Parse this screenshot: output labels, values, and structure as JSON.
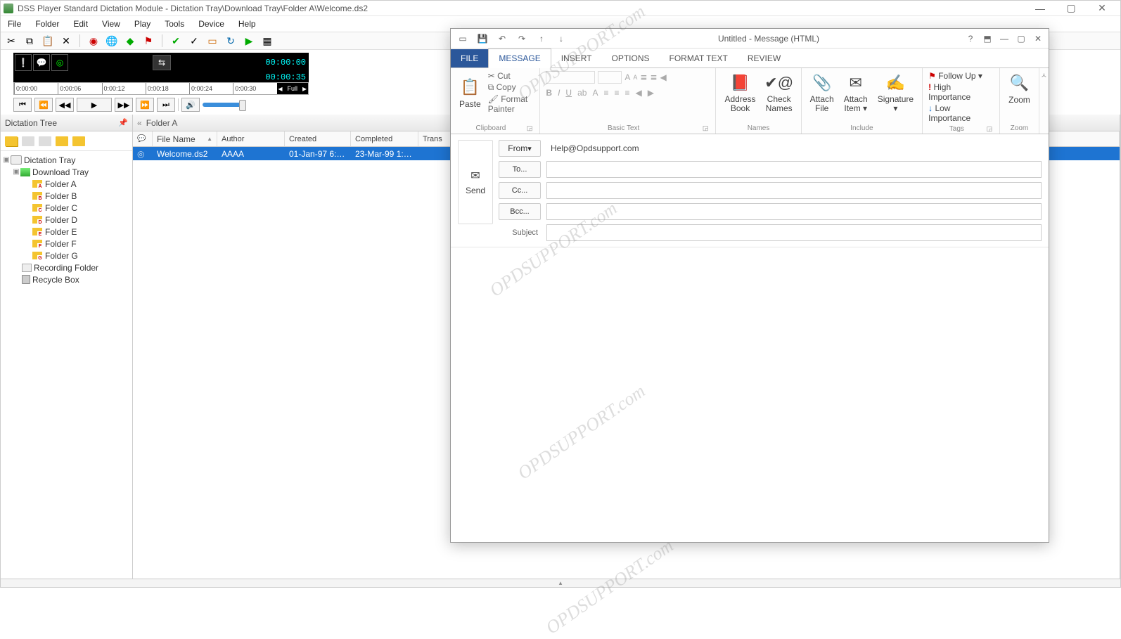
{
  "dss": {
    "title": "DSS Player Standard Dictation Module - Dictation Tray\\Download Tray\\Folder A\\Welcome.ds2",
    "menu": [
      "File",
      "Folder",
      "Edit",
      "View",
      "Play",
      "Tools",
      "Device",
      "Help"
    ],
    "time_current": "00:00:00",
    "time_total": "00:00:35",
    "ticks": [
      "0:00:00",
      "0:00:06",
      "0:00:12",
      "0:00:18",
      "0:00:24",
      "0:00:30"
    ],
    "full_label": "Full",
    "tree_header": "Dictation Tree",
    "tree": {
      "root": "Dictation Tray",
      "download": "Download Tray",
      "folders": [
        "Folder A",
        "Folder B",
        "Folder C",
        "Folder D",
        "Folder E",
        "Folder F",
        "Folder G"
      ],
      "folder_badges": [
        "A",
        "B",
        "C",
        "D",
        "E",
        "F",
        "G"
      ],
      "recording": "Recording Folder",
      "recycle": "Recycle Box"
    },
    "file_header": "Folder A",
    "columns": [
      "",
      "File Name",
      "Author",
      "Created",
      "Completed",
      "Trans"
    ],
    "row": {
      "filename": "Welcome.ds2",
      "author": "AAAA",
      "created": "01-Jan-97 6:1...",
      "completed": "23-Mar-99 1:5..."
    }
  },
  "outlook": {
    "title": "Untitled - Message (HTML)",
    "tabs": [
      "FILE",
      "MESSAGE",
      "INSERT",
      "OPTIONS",
      "FORMAT TEXT",
      "REVIEW"
    ],
    "clipboard": {
      "paste": "Paste",
      "cut": "Cut",
      "copy": "Copy",
      "format_painter": "Format Painter",
      "label": "Clipboard"
    },
    "basictext": {
      "label": "Basic Text"
    },
    "names": {
      "address_book": "Address Book",
      "check_names": "Check Names",
      "label": "Names"
    },
    "include": {
      "attach_file": "Attach File",
      "attach_item": "Attach Item",
      "signature": "Signature",
      "label": "Include"
    },
    "tags": {
      "follow": "Follow Up",
      "high": "High Importance",
      "low": "Low Importance",
      "label": "Tags"
    },
    "zoom": {
      "zoom": "Zoom",
      "label": "Zoom"
    },
    "send": "Send",
    "from_label": "From",
    "from_value": "Help@Opdsupport.com",
    "to_label": "To...",
    "cc_label": "Cc...",
    "bcc_label": "Bcc...",
    "subject_label": "Subject"
  },
  "watermark": "OPDSUPPORT.com"
}
